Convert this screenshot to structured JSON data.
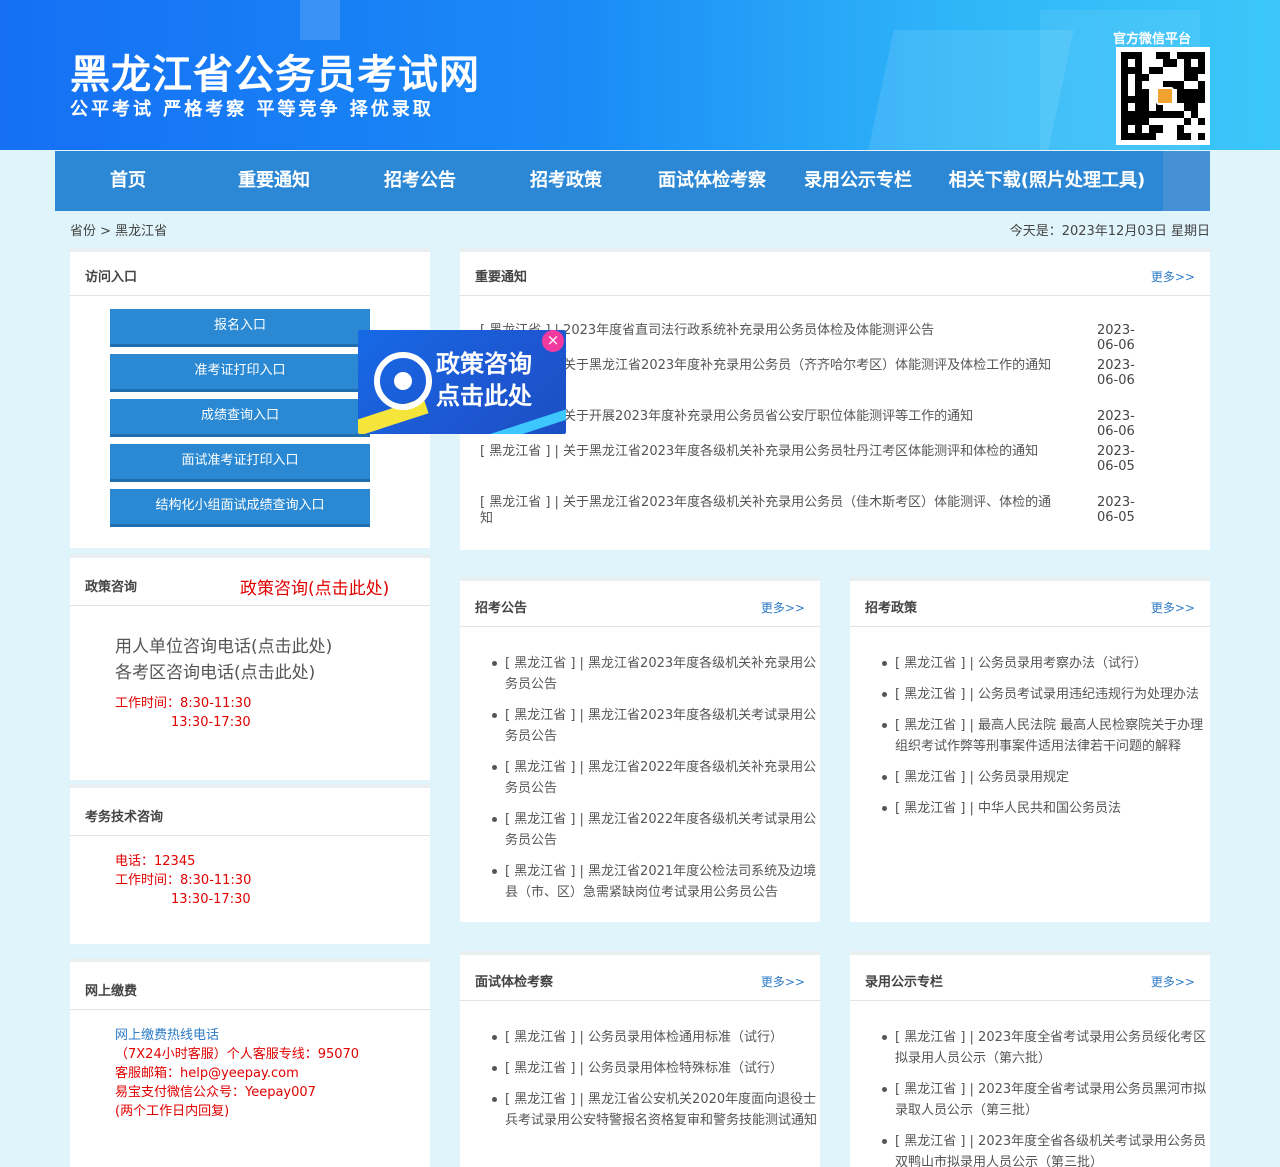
{
  "header": {
    "title": "黑龙江省公务员考试网",
    "slogan": "公平考试 严格考察 平等竞争 择优录取",
    "wechat_label": "官方微信平台"
  },
  "nav": {
    "items": [
      "首页",
      "重要通知",
      "招考公告",
      "招考政策",
      "面试体检考察",
      "录用公示专栏",
      "相关下载(照片处理工具)"
    ]
  },
  "breadcrumb": {
    "text": "省份 > 黑龙江省"
  },
  "today": "今天是：2023年12月03日 星期日",
  "more_label": "更多>>",
  "access": {
    "title": "访问入口",
    "buttons": [
      "报名入口",
      "准考证打印入口",
      "成绩查询入口",
      "面试准考证打印入口",
      "结构化小组面试成绩查询入口"
    ]
  },
  "policy": {
    "title": "政策咨询",
    "link": "政策咨询(点击此处)",
    "line1": "用人单位咨询电话(点击此处)",
    "line2": "各考区咨询电话(点击此处)",
    "hours1": "工作时间：8:30-11:30",
    "hours2": "13:30-17:30"
  },
  "tech": {
    "title": "考务技术咨询",
    "phone": "电话：12345",
    "hours1": "工作时间：8:30-11:30",
    "hours2": "13:30-17:30"
  },
  "payment": {
    "title": "网上缴费",
    "hotline": "网上缴费热线电话",
    "service": "（7X24小时客服）个人客服专线：95070",
    "email": "客服邮箱：help@yeepay.com",
    "wechat": "易宝支付微信公众号：Yeepay007",
    "reply": "(两个工作日内回复)"
  },
  "notices": {
    "title": "重要通知",
    "items": [
      {
        "text": "[ 黑龙江省 ] | 2023年度省直司法行政系统补充录用公务员体检及体能测评公告",
        "date": "2023-06-06"
      },
      {
        "text": "[ 黑龙江省 ] | 关于黑龙江省2023年度补充录用公务员（齐齐哈尔考区）体能测评及体检工作的通知",
        "date": "2023-06-06"
      },
      {
        "text": "[ 黑龙江省 ] | 关于开展2023年度补充录用公务员省公安厅职位体能测评等工作的通知",
        "date": "2023-06-06"
      },
      {
        "text": "[ 黑龙江省 ] | 关于黑龙江省2023年度各级机关补充录用公务员牡丹江考区体能测评和体检的通知",
        "date": "2023-06-05"
      },
      {
        "text": "[ 黑龙江省 ] | 关于黑龙江省2023年度各级机关补充录用公务员（佳木斯考区）体能测评、体检的通知",
        "date": "2023-06-05"
      }
    ]
  },
  "announcements": {
    "title": "招考公告",
    "items": [
      "[ 黑龙江省 ] | 黑龙江省2023年度各级机关补充录用公务员公告",
      "[ 黑龙江省 ] | 黑龙江省2023年度各级机关考试录用公务员公告",
      "[ 黑龙江省 ] | 黑龙江省2022年度各级机关补充录用公务员公告",
      "[ 黑龙江省 ] | 黑龙江省2022年度各级机关考试录用公务员公告",
      "[ 黑龙江省 ] | 黑龙江省2021年度公检法司系统及边境县（市、区）急需紧缺岗位考试录用公务员公告"
    ]
  },
  "policies": {
    "title": "招考政策",
    "items": [
      "[ 黑龙江省 ] | 公务员录用考察办法（试行）",
      "[ 黑龙江省 ] | 公务员考试录用违纪违规行为处理办法",
      "[ 黑龙江省 ] | 最高人民法院 最高人民检察院关于办理组织考试作弊等刑事案件适用法律若干问题的解释",
      "[ 黑龙江省 ] | 公务员录用规定",
      "[ 黑龙江省 ] | 中华人民共和国公务员法"
    ]
  },
  "interview": {
    "title": "面试体检考察",
    "items": [
      "[ 黑龙江省 ] | 公务员录用体检通用标准（试行）",
      "[ 黑龙江省 ] | 公务员录用体检特殊标准（试行）",
      "[ 黑龙江省 ] | 黑龙江省公安机关2020年度面向退役士兵考试录用公安特警报名资格复审和警务技能测试通知"
    ]
  },
  "publicity": {
    "title": "录用公示专栏",
    "items": [
      "[ 黑龙江省 ] | 2023年度全省考试录用公务员绥化考区拟录用人员公示（第六批）",
      "[ 黑龙江省 ] | 2023年度全省考试录用公务员黑河市拟录取人员公示（第三批）",
      "[ 黑龙江省 ] | 2023年度全省各级机关考试录用公务员双鸭山市拟录用人员公示（第三批）"
    ]
  },
  "popup": {
    "line1": "政策咨询",
    "line2": "点击此处",
    "close": "×"
  }
}
